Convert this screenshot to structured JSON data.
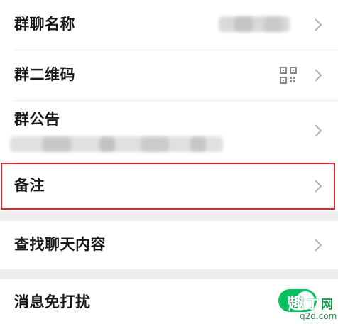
{
  "settings": {
    "group_name_label": "群聊名称",
    "qr_code_label": "群二维码",
    "announcement_label": "群公告",
    "remark_label": "备注",
    "search_chat_label": "查找聊天内容",
    "mute_label": "消息免打扰",
    "mute_enabled": true
  },
  "icons": {
    "chevron": "chevron-right-icon",
    "qr": "qr-code-icon"
  },
  "colors": {
    "highlight": "#e0282d",
    "toggle_on": "#07c160",
    "chevron": "#b2b2b2",
    "section_gap": "#ededed"
  },
  "watermark": {
    "char1": "趣",
    "char2": "丁",
    "char3": "网",
    "domain": "q2d.com"
  }
}
